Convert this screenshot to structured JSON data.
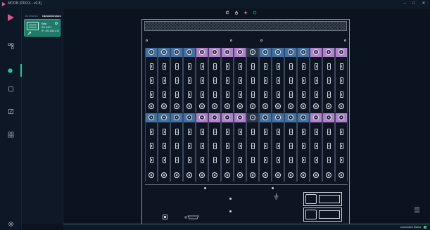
{
  "window": {
    "title": "MOOB (PROX - v0.8)",
    "minimize": "–",
    "maximize": "□",
    "close": "✕"
  },
  "rail": {
    "items": [
      {
        "name": "device-list",
        "icon": "device-tree-icon"
      },
      {
        "name": "active-view",
        "icon": "dot-icon"
      },
      {
        "name": "screen",
        "icon": "square-icon"
      },
      {
        "name": "edit",
        "icon": "edit-icon"
      },
      {
        "name": "layout",
        "icon": "grid-icon"
      }
    ],
    "settings_icon": "gear-icon"
  },
  "device_panel": {
    "tab_all": "All Devices",
    "tab_owned": "Owned Devices",
    "device": {
      "name": "Grid",
      "sn": "SN: 5407",
      "ip": "IP: 192.168.1.10"
    }
  },
  "toolbar": {
    "items": [
      "refresh-icon",
      "lock-icon",
      "move-icon",
      "target-icon"
    ]
  },
  "status": {
    "connection": "Connection Status"
  },
  "colors": {
    "accent": "#20c997",
    "input_strip": "#3f72a8",
    "output_strip": "#b37ecf",
    "status_ok": "#2bc37e"
  }
}
